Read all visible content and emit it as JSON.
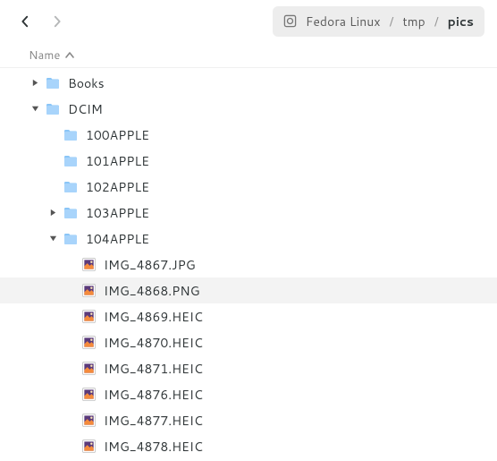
{
  "breadcrumb": {
    "root": "Fedora Linux",
    "mid": "tmp",
    "current": "pics"
  },
  "column": {
    "name": "Name"
  },
  "tree": [
    {
      "depth": 0,
      "type": "folder",
      "expand": "closed",
      "label": "Books"
    },
    {
      "depth": 0,
      "type": "folder",
      "expand": "open",
      "label": "DCIM"
    },
    {
      "depth": 1,
      "type": "folder",
      "expand": "none",
      "label": "100APPLE"
    },
    {
      "depth": 1,
      "type": "folder",
      "expand": "none",
      "label": "101APPLE"
    },
    {
      "depth": 1,
      "type": "folder",
      "expand": "none",
      "label": "102APPLE"
    },
    {
      "depth": 1,
      "type": "folder",
      "expand": "closed",
      "label": "103APPLE"
    },
    {
      "depth": 1,
      "type": "folder",
      "expand": "open",
      "label": "104APPLE"
    },
    {
      "depth": 2,
      "type": "image",
      "expand": "none",
      "label": "IMG_4867.JPG"
    },
    {
      "depth": 2,
      "type": "image",
      "expand": "none",
      "label": "IMG_4868.PNG",
      "selected": true
    },
    {
      "depth": 2,
      "type": "image",
      "expand": "none",
      "label": "IMG_4869.HEIC"
    },
    {
      "depth": 2,
      "type": "image",
      "expand": "none",
      "label": "IMG_4870.HEIC"
    },
    {
      "depth": 2,
      "type": "image",
      "expand": "none",
      "label": "IMG_4871.HEIC"
    },
    {
      "depth": 2,
      "type": "image",
      "expand": "none",
      "label": "IMG_4876.HEIC"
    },
    {
      "depth": 2,
      "type": "image",
      "expand": "none",
      "label": "IMG_4877.HEIC"
    },
    {
      "depth": 2,
      "type": "image",
      "expand": "none",
      "label": "IMG_4878.HEIC"
    }
  ]
}
